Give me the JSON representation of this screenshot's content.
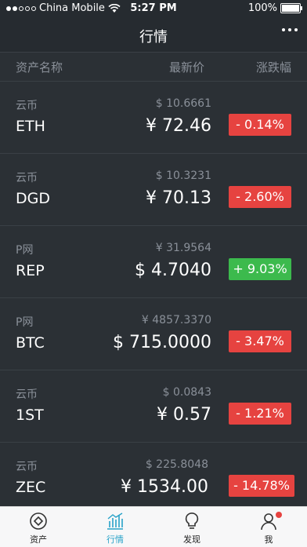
{
  "status": {
    "carrier": "China Mobile",
    "time": "5:27 PM",
    "battery": "100%"
  },
  "nav": {
    "title": "行情"
  },
  "columns": {
    "asset": "资产名称",
    "price": "最新价",
    "change": "涨跌幅"
  },
  "rows": [
    {
      "market": "云币",
      "symbol": "ETH",
      "usd": "$ 10.6661",
      "price": "¥ 72.46",
      "change": "- 0.14%",
      "dir": "down"
    },
    {
      "market": "云币",
      "symbol": "DGD",
      "usd": "$ 10.3231",
      "price": "¥ 70.13",
      "change": "- 2.60%",
      "dir": "down"
    },
    {
      "market": "P网",
      "symbol": "REP",
      "usd": "¥ 31.9564",
      "price": "$ 4.7040",
      "change": "+ 9.03%",
      "dir": "up"
    },
    {
      "market": "P网",
      "symbol": "BTC",
      "usd": "¥ 4857.3370",
      "price": "$ 715.0000",
      "change": "- 3.47%",
      "dir": "down"
    },
    {
      "market": "云币",
      "symbol": "1ST",
      "usd": "$ 0.0843",
      "price": "¥ 0.57",
      "change": "- 1.21%",
      "dir": "down"
    },
    {
      "market": "云币",
      "symbol": "ZEC",
      "usd": "$ 225.8048",
      "price": "¥ 1534.00",
      "change": "- 14.78%",
      "dir": "down"
    }
  ],
  "tabs": [
    {
      "label": "资产",
      "icon": "assets-icon"
    },
    {
      "label": "行情",
      "icon": "market-chart-icon",
      "active": true
    },
    {
      "label": "发现",
      "icon": "lightbulb-icon"
    },
    {
      "label": "我",
      "icon": "profile-icon"
    }
  ],
  "colors": {
    "background": "#2b3035",
    "up": "#3cba4d",
    "down": "#e64340",
    "accent": "#27a2c8"
  }
}
